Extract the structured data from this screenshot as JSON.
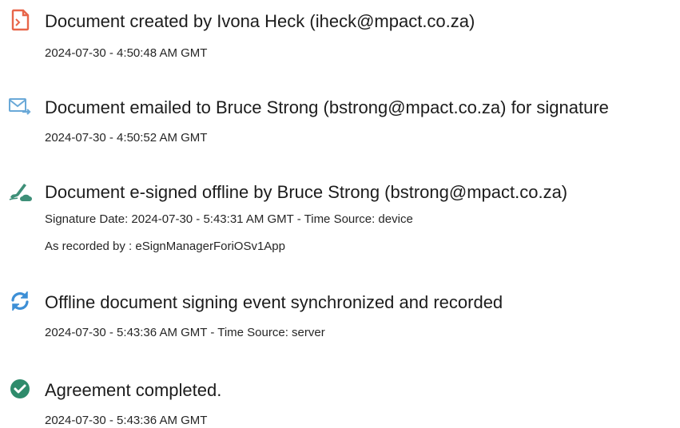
{
  "events": [
    {
      "icon": "document-created-icon",
      "title": "Document created by Ivona Heck (iheck@mpact.co.za)",
      "details": [
        "2024-07-30 - 4:50:48 AM GMT"
      ]
    },
    {
      "icon": "email-sent-icon",
      "title": "Document emailed to Bruce Strong (bstrong@mpact.co.za) for signature",
      "details": [
        "2024-07-30 - 4:50:52 AM GMT"
      ]
    },
    {
      "icon": "offline-esign-icon",
      "title": "Document e-signed offline by Bruce Strong (bstrong@mpact.co.za)",
      "details": [
        "Signature Date: 2024-07-30 - 5:43:31 AM GMT - Time Source: device",
        "As recorded by : eSignManagerForiOSv1App"
      ]
    },
    {
      "icon": "sync-icon",
      "title": "Offline document signing event synchronized and recorded",
      "details": [
        "2024-07-30 - 5:43:36 AM GMT - Time Source: server"
      ]
    },
    {
      "icon": "completed-check-icon",
      "title": "Agreement completed.",
      "details": [
        "2024-07-30 - 5:43:36 AM GMT"
      ]
    }
  ],
  "colors": {
    "created_icon": "#e8664a",
    "email_icon": "#6aa9d8",
    "esign_icon": "#3e8f78",
    "sync_icon": "#3d8fd6",
    "completed_icon": "#2e8b6b"
  }
}
